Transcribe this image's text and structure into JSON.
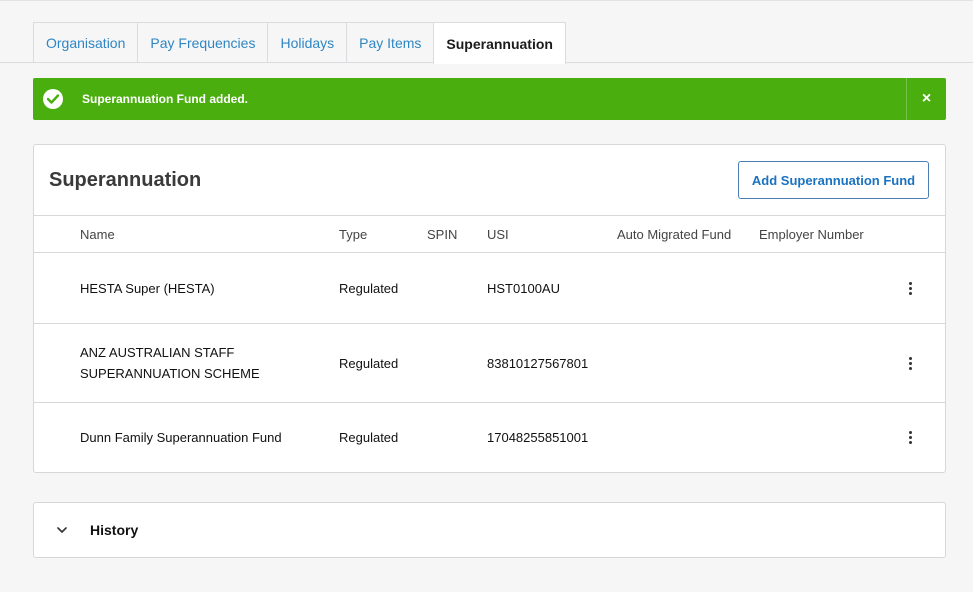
{
  "tabs": [
    {
      "label": "Organisation",
      "active": false
    },
    {
      "label": "Pay Frequencies",
      "active": false
    },
    {
      "label": "Holidays",
      "active": false
    },
    {
      "label": "Pay Items",
      "active": false
    },
    {
      "label": "Superannuation",
      "active": true
    }
  ],
  "alert": {
    "message": "Superannuation Fund added.",
    "close_label": "×",
    "color": "#4bae0f",
    "icon": "check-circle-icon"
  },
  "card": {
    "title": "Superannuation",
    "add_button_label": "Add Superannuation Fund",
    "columns": {
      "name": "Name",
      "type": "Type",
      "spin": "SPIN",
      "usi": "USI",
      "auto_migrated": "Auto Migrated Fund",
      "employer_number": "Employer Number"
    },
    "rows": [
      {
        "name": "HESTA Super (HESTA)",
        "type": "Regulated",
        "spin": "",
        "usi": "HST0100AU",
        "auto_migrated": "",
        "employer_number": ""
      },
      {
        "name": "ANZ AUSTRALIAN STAFF SUPERANNUATION SCHEME",
        "type": "Regulated",
        "spin": "",
        "usi": "83810127567801",
        "auto_migrated": "",
        "employer_number": ""
      },
      {
        "name": "Dunn Family Superannuation Fund",
        "type": "Regulated",
        "spin": "",
        "usi": "17048255851001",
        "auto_migrated": "",
        "employer_number": ""
      }
    ]
  },
  "history": {
    "label": "History",
    "icon": "chevron-down-icon"
  },
  "colors": {
    "link": "#2f86c3",
    "success": "#4bae0f",
    "button_text": "#1a73c0"
  }
}
